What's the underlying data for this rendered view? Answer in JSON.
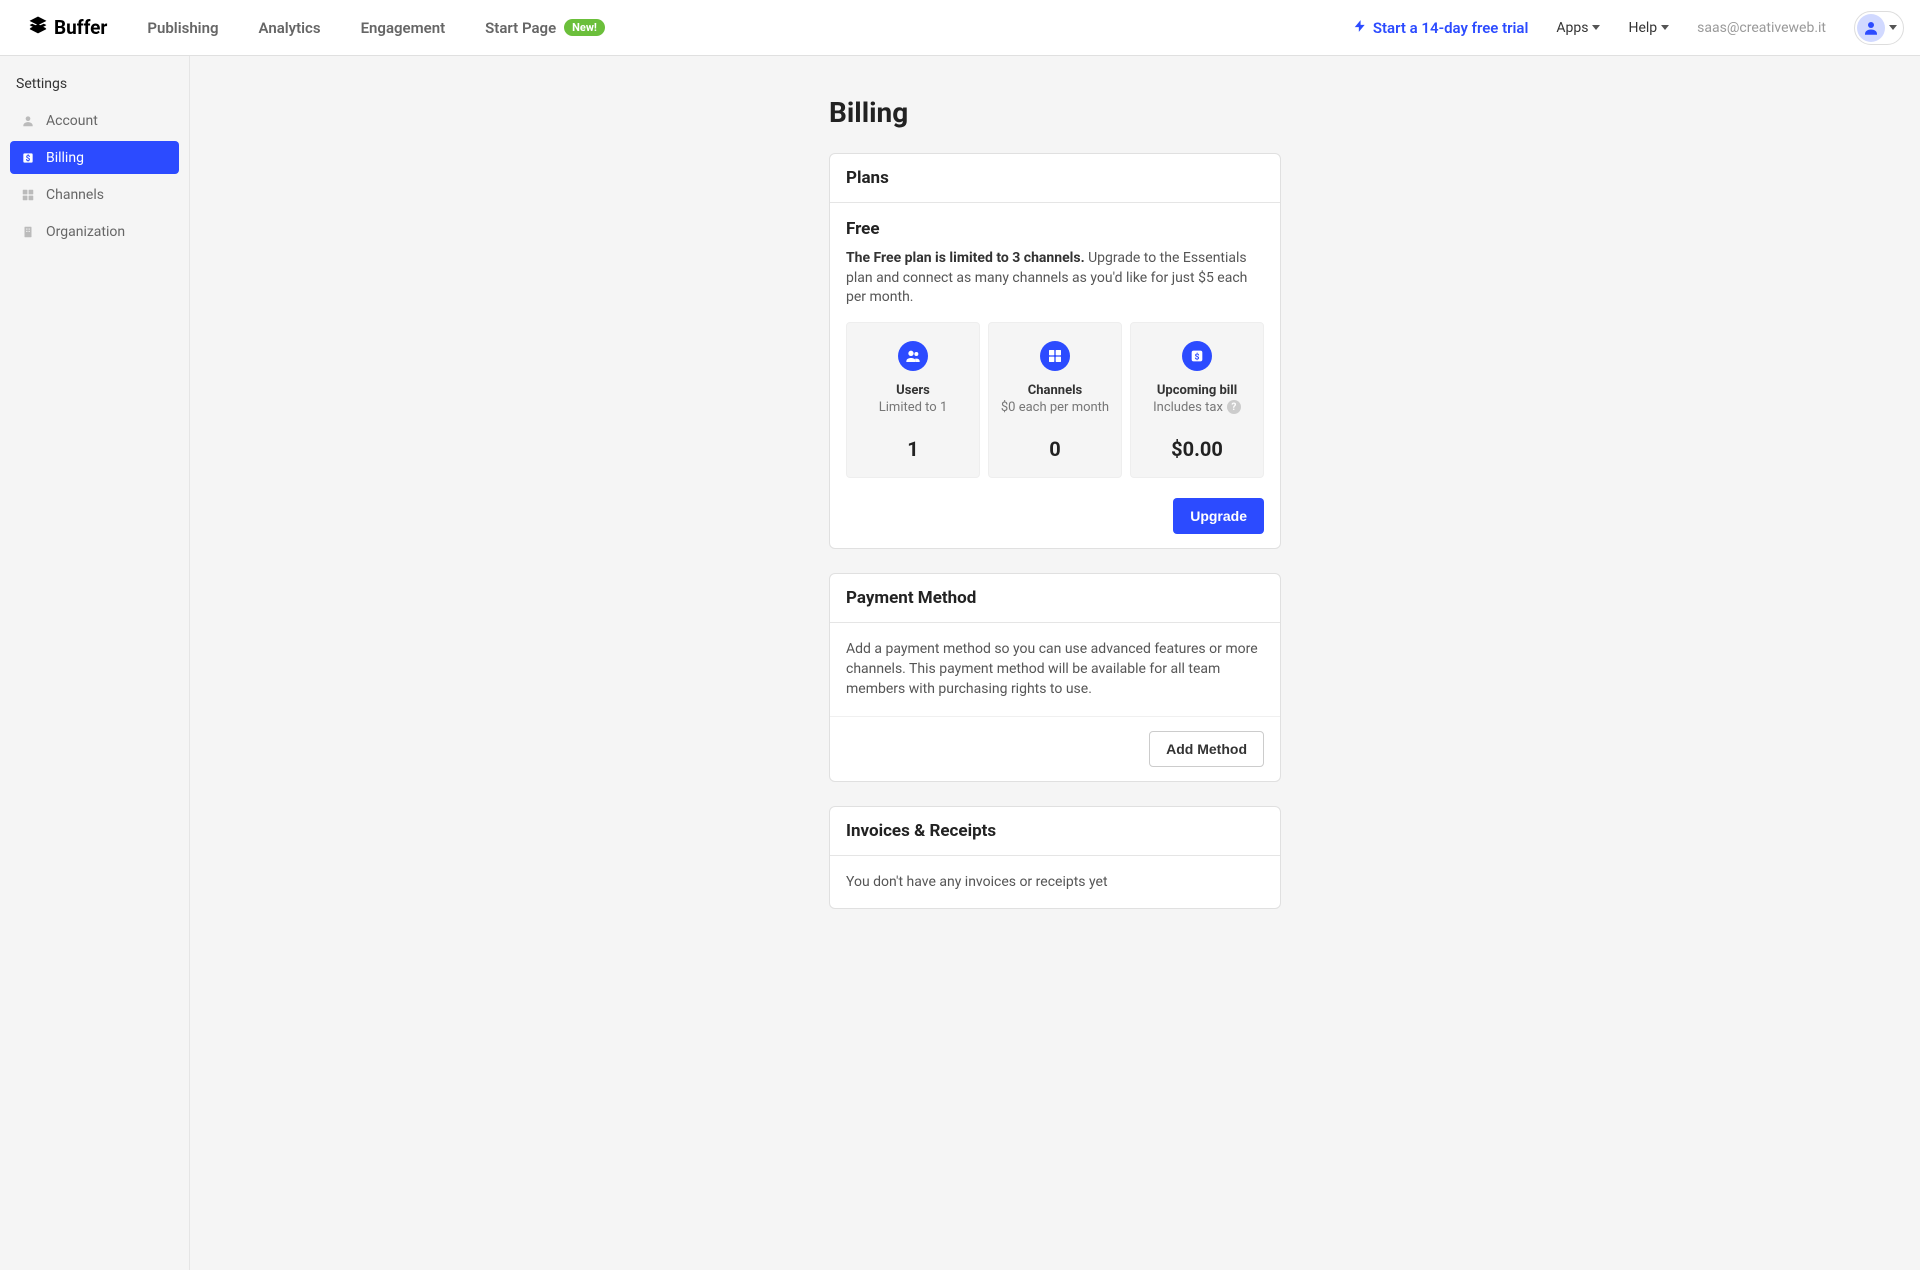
{
  "header": {
    "brand": "Buffer",
    "nav": [
      "Publishing",
      "Analytics",
      "Engagement",
      "Start Page"
    ],
    "start_page_badge": "New!",
    "trial_link": "Start a 14-day free trial",
    "apps_label": "Apps",
    "help_label": "Help",
    "email": "saas@creativeweb.it"
  },
  "sidebar": {
    "title": "Settings",
    "items": [
      {
        "label": "Account"
      },
      {
        "label": "Billing"
      },
      {
        "label": "Channels"
      },
      {
        "label": "Organization"
      }
    ]
  },
  "page": {
    "title": "Billing"
  },
  "plans": {
    "card_title": "Plans",
    "plan_name": "Free",
    "desc_bold": "The Free plan is limited to 3 channels.",
    "desc_rest": " Upgrade to the Essentials plan and connect as many channels as you'd like for just $5 each per month.",
    "stats": [
      {
        "title": "Users",
        "sub": "Limited to 1",
        "value": "1"
      },
      {
        "title": "Channels",
        "sub": "$0 each per month",
        "value": "0"
      },
      {
        "title": "Upcoming bill",
        "sub": "Includes tax",
        "value": "$0.00",
        "help": true
      }
    ],
    "upgrade_label": "Upgrade"
  },
  "payment": {
    "card_title": "Payment Method",
    "body": "Add a payment method so you can use advanced features or more channels. This payment method will be available for all team members with purchasing rights to use.",
    "add_label": "Add Method"
  },
  "invoices": {
    "card_title": "Invoices & Receipts",
    "body": "You don't have any invoices or receipts yet"
  }
}
